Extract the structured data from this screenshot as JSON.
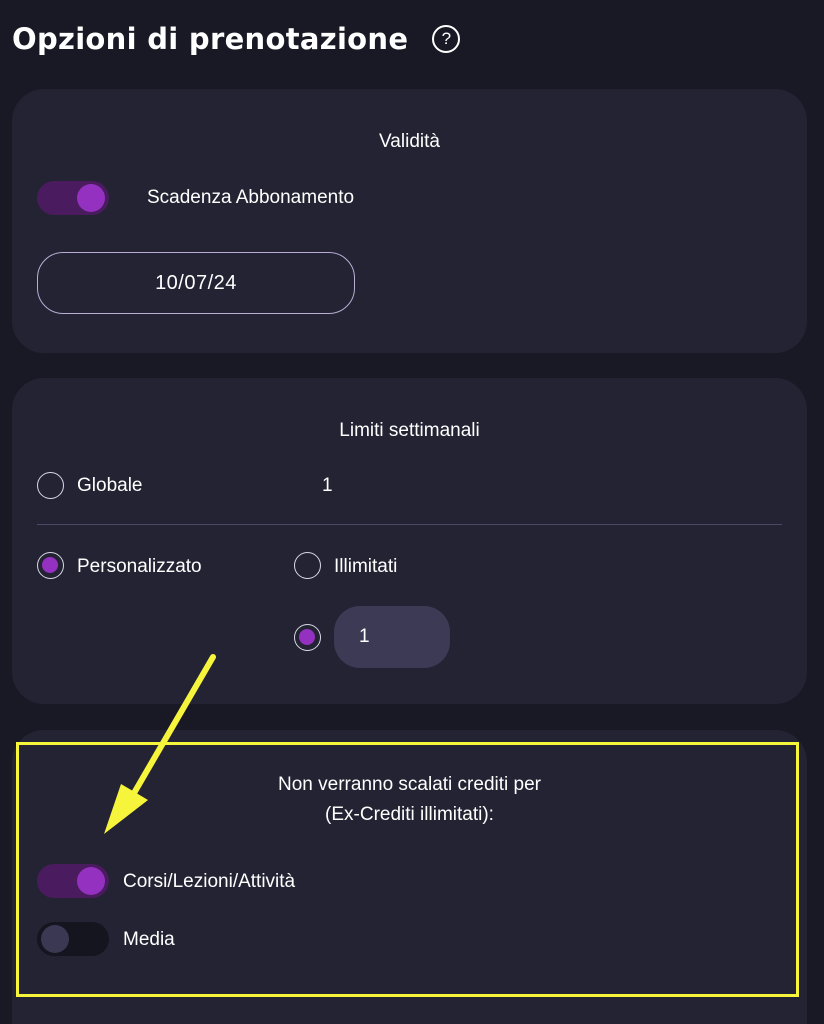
{
  "header": {
    "title": "Opzioni di prenotazione",
    "help_glyph": "?"
  },
  "validita": {
    "title": "Validità",
    "expiry_toggle": {
      "label": "Scadenza Abbonamento",
      "on": true
    },
    "date_value": "10/07/24"
  },
  "limiti": {
    "title": "Limiti settimanali",
    "globale": {
      "label": "Globale",
      "value": "1",
      "checked": false
    },
    "personalizzato": {
      "label": "Personalizzato",
      "checked": true
    },
    "illimitati": {
      "label": "Illimitati",
      "checked": false
    },
    "custom_value": "1",
    "custom_checked": true
  },
  "crediti": {
    "note_line1": "Non verranno scalati crediti per",
    "note_line2": "(Ex-Crediti illimitati):",
    "toggles": [
      {
        "label": "Corsi/Lezioni/Attività",
        "on": true
      },
      {
        "label": "Media",
        "on": false
      }
    ]
  },
  "colors": {
    "background": "#191925",
    "card": "#232333",
    "accent": "#9431c0",
    "highlight": "#f7f53b"
  },
  "icons": {
    "help": "help-circle-icon",
    "annotation": "yellow-arrow-icon"
  }
}
